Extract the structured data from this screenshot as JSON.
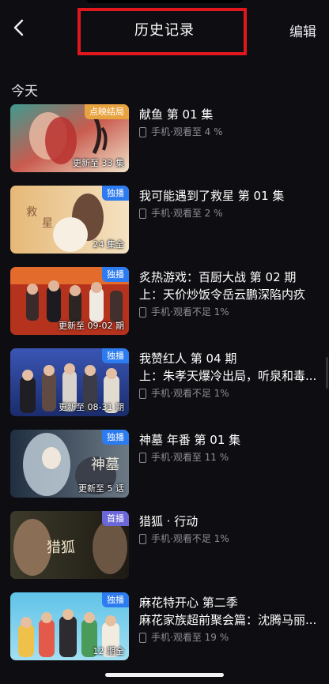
{
  "header": {
    "title": "历史记录",
    "edit_label": "编辑"
  },
  "section": {
    "title": "今天"
  },
  "items": [
    {
      "title": "献鱼 第 01 集",
      "subtitle": "",
      "device": "手机",
      "progress": "观看至 4 %",
      "badge": "点映结局",
      "badge_color": "#e8a341",
      "thumb_caption": "更新至 33 集"
    },
    {
      "title": "我可能遇到了救星 第 01 集",
      "subtitle": "",
      "device": "手机",
      "progress": "观看至 2 %",
      "badge": "独播",
      "badge_color": "#2d7bf0",
      "thumb_caption": "24 集全"
    },
    {
      "title": "炙热游戏：百厨大战 第 02 期",
      "subtitle": "上：天价炒饭令岳云鹏深陷内疚",
      "device": "手机",
      "progress": "观看不足 1%",
      "badge": "独播",
      "badge_color": "#2d7bf0",
      "thumb_caption": "更新至 09-02 期"
    },
    {
      "title": "我赞红人 第 04 期",
      "subtitle": "上：朱孝天爆冷出局，听泉和毒...",
      "device": "手机",
      "progress": "观看不足 1%",
      "badge": "独播",
      "badge_color": "#2d7bf0",
      "thumb_caption": "更新至 08-31 期"
    },
    {
      "title": "神墓 年番 第 01 集",
      "subtitle": "",
      "device": "手机",
      "progress": "观看至 11 %",
      "badge": "独播",
      "badge_color": "#2d7bf0",
      "thumb_caption": "更新至 5 话"
    },
    {
      "title": "猎狐 · 行动",
      "subtitle": "",
      "device": "手机",
      "progress": "观看不足 1%",
      "badge": "首播",
      "badge_color": "#6c67d9",
      "thumb_caption": ""
    },
    {
      "title": "麻花特开心 第二季",
      "subtitle": "麻花家族超前聚会篇：沈腾马丽...",
      "device": "手机",
      "progress": "观看至 19 %",
      "badge": "独播",
      "badge_color": "#2d7bf0",
      "thumb_caption": "12 期全"
    }
  ]
}
